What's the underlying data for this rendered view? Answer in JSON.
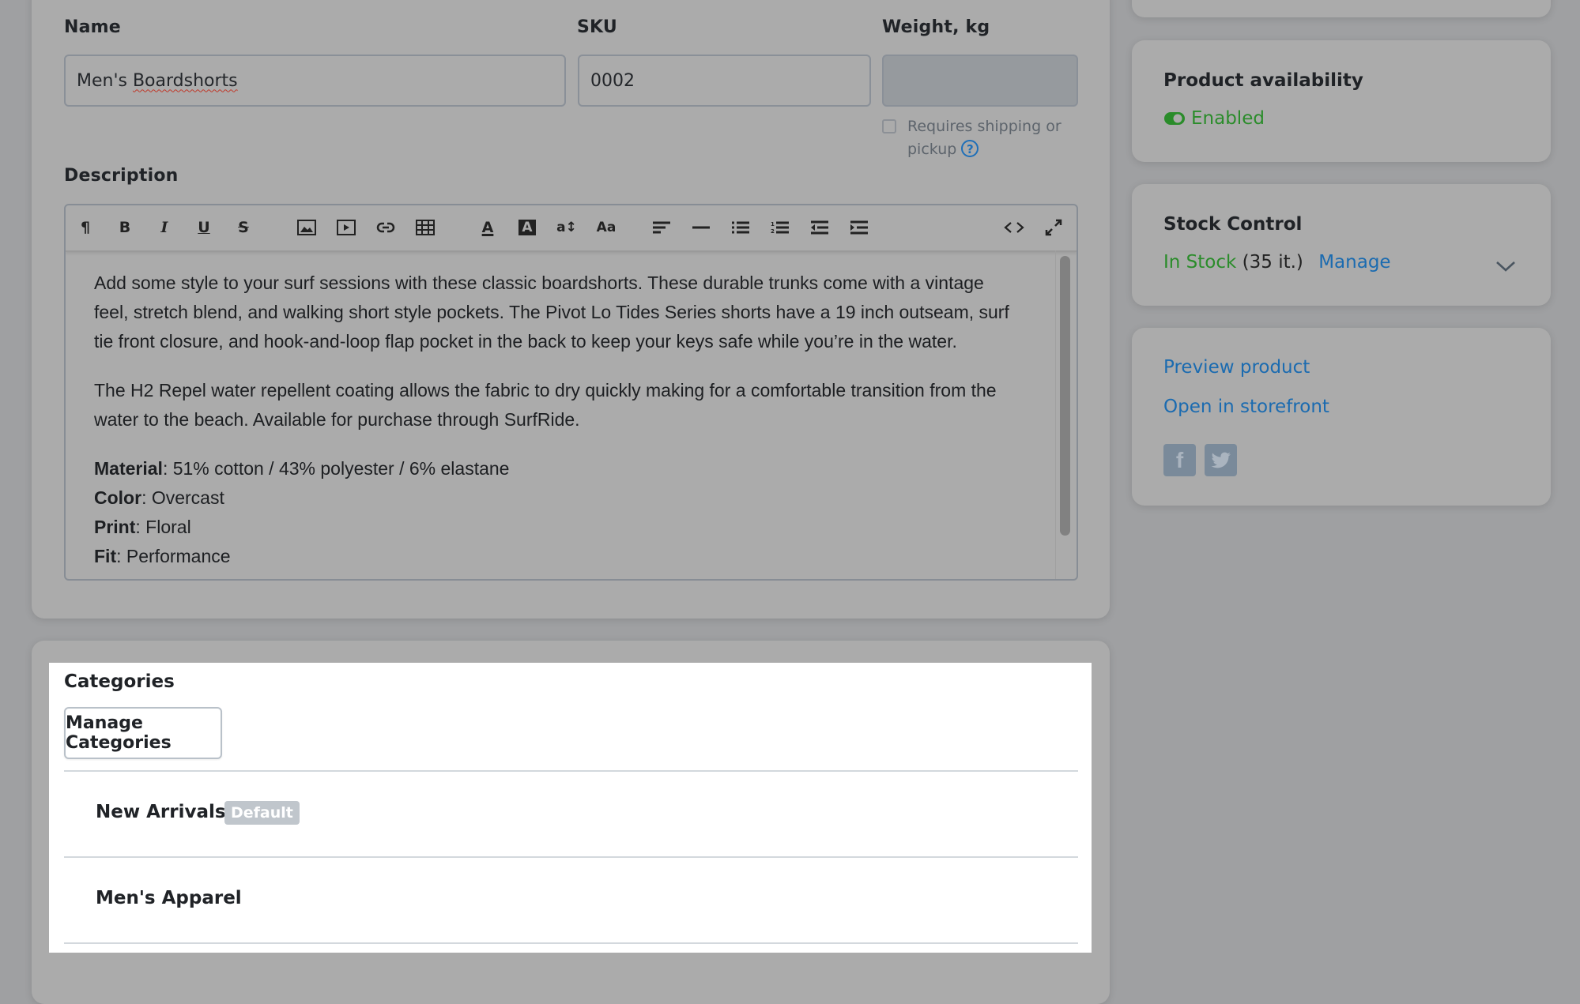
{
  "product_form": {
    "name_label": "Name",
    "name_value": "Men's ",
    "name_value_misspelled": "Boardshorts",
    "sku_label": "SKU",
    "sku_value": "0002",
    "weight_label": "Weight, kg",
    "weight_value": "",
    "requires_shipping_label_line1": "Requires shipping or",
    "requires_shipping_label_line2": "pickup",
    "requires_shipping_checked": false,
    "help_icon": "?",
    "description_label": "Description"
  },
  "editor": {
    "toolbar": [
      {
        "name": "paragraph-format",
        "glyph": "¶"
      },
      {
        "name": "bold",
        "glyph": "B"
      },
      {
        "name": "italic",
        "glyph": "I"
      },
      {
        "name": "underline",
        "glyph": "U"
      },
      {
        "name": "strikethrough",
        "glyph": "S"
      },
      {
        "name": "insert-image",
        "glyph": "image"
      },
      {
        "name": "insert-video",
        "glyph": "video"
      },
      {
        "name": "insert-link",
        "glyph": "link"
      },
      {
        "name": "insert-table",
        "glyph": "table"
      },
      {
        "name": "text-color",
        "glyph": "A"
      },
      {
        "name": "background-color",
        "glyph": "A"
      },
      {
        "name": "font-size",
        "glyph": "a↕"
      },
      {
        "name": "font-family",
        "glyph": "Aa"
      },
      {
        "name": "align",
        "glyph": "align"
      },
      {
        "name": "horizontal-line",
        "glyph": "—"
      },
      {
        "name": "bulleted-list",
        "glyph": "ul"
      },
      {
        "name": "numbered-list",
        "glyph": "ol"
      },
      {
        "name": "outdent",
        "glyph": "outdent"
      },
      {
        "name": "indent",
        "glyph": "indent"
      },
      {
        "name": "code-view",
        "glyph": "<>"
      },
      {
        "name": "fullscreen",
        "glyph": "expand"
      }
    ],
    "paragraphs": [
      "Add some style to your surf sessions with these classic boardshorts. These durable trunks come with a vintage feel, stretch blend, and walking short style pockets. The Pivot Lo Tides Series shorts have a 19 inch outseam, surf tie front closure, and hook-and-loop flap pocket in the back to keep your keys safe while you’re in the water.",
      "The H2 Repel water repellent coating allows the fabric to dry quickly making for a comfortable transition from the water to the beach. Available for purchase through SurfRide."
    ],
    "attributes": [
      {
        "key": "Material",
        "value": ": 51% cotton / 43% polyester / 6% elastane"
      },
      {
        "key": "Color",
        "value": ": Overcast"
      },
      {
        "key": "Print",
        "value": ": Floral"
      },
      {
        "key": "Fit",
        "value": ": Performance"
      }
    ]
  },
  "categories": {
    "title": "Categories",
    "manage_button": "Manage Categories",
    "items": [
      {
        "name": "New Arrivals",
        "badge": "Default"
      },
      {
        "name": "Men's Apparel",
        "badge": null
      }
    ]
  },
  "sidebar": {
    "availability": {
      "title": "Product availability",
      "status": "Enabled",
      "status_color": "#2a8c2a"
    },
    "stock": {
      "title": "Stock Control",
      "status": "In Stock",
      "count": "(35 it.)",
      "manage_link": "Manage",
      "status_color": "#2a8c2a"
    },
    "links": {
      "preview": "Preview product",
      "storefront": "Open in storefront",
      "social": [
        {
          "name": "facebook",
          "glyph": "f"
        },
        {
          "name": "twitter",
          "glyph": "twitter"
        }
      ]
    }
  },
  "colors": {
    "link": "#1b6bb0",
    "success": "#2a8c2a",
    "overlay_bg": "#9fa0a2"
  }
}
